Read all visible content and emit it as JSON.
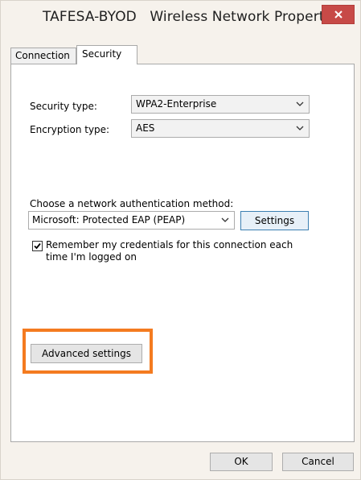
{
  "window": {
    "title": "TAFESA-BYOD   Wireless Network Properties",
    "close_icon": "close-icon",
    "accent_close": "#c74a47",
    "highlight_color": "#f47b20"
  },
  "tabs": [
    {
      "label": "Connection",
      "selected": false
    },
    {
      "label": "Security",
      "selected": true
    }
  ],
  "security": {
    "security_type_label": "Security type:",
    "security_type_value": "WPA2-Enterprise",
    "encryption_type_label": "Encryption type:",
    "encryption_type_value": "AES",
    "auth_method_label": "Choose a network authentication method:",
    "auth_method_value": "Microsoft: Protected EAP (PEAP)",
    "settings_label": "Settings",
    "remember_line1": "Remember my credentials for this connection each",
    "remember_line2": "time I'm logged on",
    "remember_checked": true,
    "advanced_label": "Advanced settings"
  },
  "footer": {
    "ok_label": "OK",
    "cancel_label": "Cancel"
  }
}
